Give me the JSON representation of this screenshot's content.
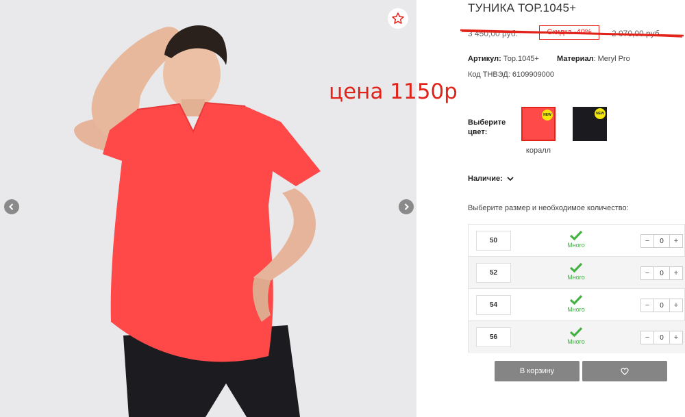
{
  "product": {
    "title": "ТУНИКА ТОР.1045+",
    "old_price": "3 450,00 руб.",
    "discount": "Скидка -40%",
    "new_price": "2 070,00 руб.",
    "article_label": "Артикул:",
    "article_value": "Тор.1045+",
    "material_label": "Материал",
    "material_value": ": Meryl Pro",
    "tnved": "Код ТНВЭД: 6109909000"
  },
  "annotation": "цена 1150р",
  "colors": {
    "label": "Выберите цвет:",
    "items": [
      {
        "name": "коралл",
        "badge": "NEW",
        "hex": "#ff4a4a"
      },
      {
        "name": "",
        "badge": "NEW",
        "hex": "#1b1b1f"
      }
    ]
  },
  "availability_label": "Наличие:",
  "size_prompt": "Выберите размер и необходимое количество:",
  "sizes": [
    {
      "size": "50",
      "stock": "Много",
      "qty": "0"
    },
    {
      "size": "52",
      "stock": "Много",
      "qty": "0"
    },
    {
      "size": "54",
      "stock": "Много",
      "qty": "0"
    },
    {
      "size": "56",
      "stock": "Много",
      "qty": "0"
    }
  ],
  "stepper": {
    "minus": "−",
    "plus": "+"
  },
  "buttons": {
    "cart": "В корзину",
    "wishlist_icon": "heart-icon"
  },
  "palette": {
    "accent_red": "#e2231a",
    "button_grey": "#858585",
    "stock_green": "#43b243"
  }
}
